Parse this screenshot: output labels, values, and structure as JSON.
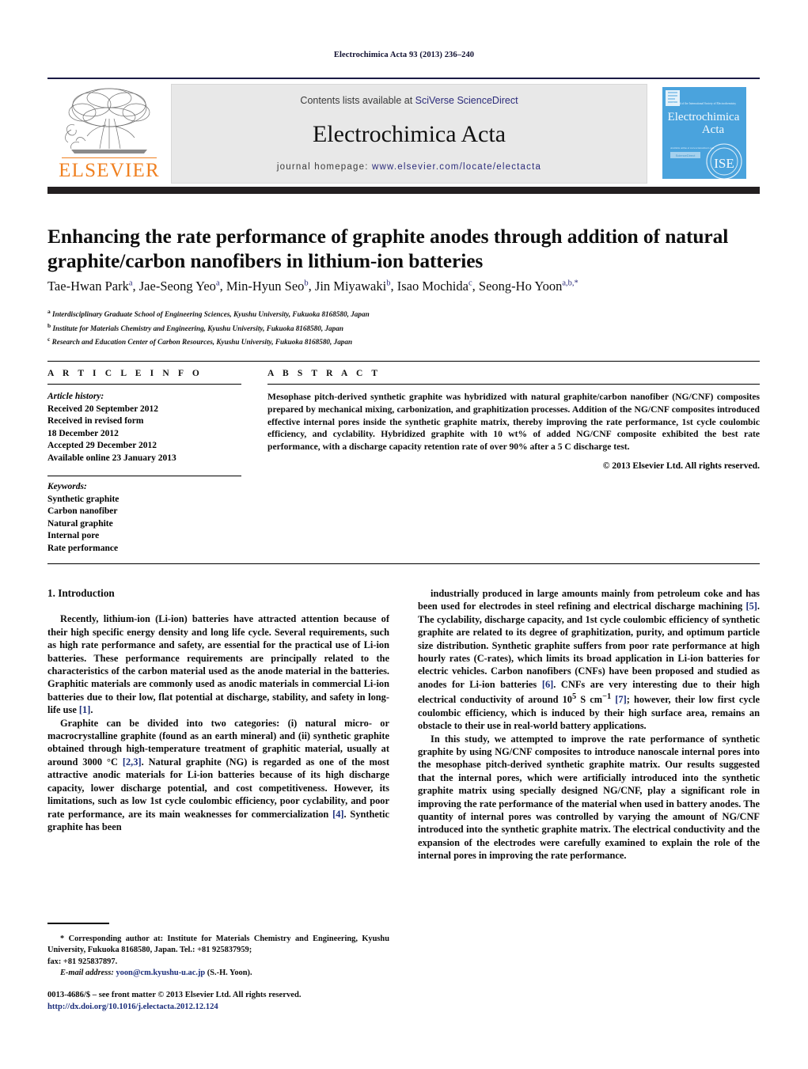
{
  "running_head": "Electrochimica Acta 93 (2013) 236–240",
  "masthead": {
    "contents_prefix": "Contents lists available at ",
    "contents_link": "SciVerse ScienceDirect",
    "journal_title": "Electrochimica Acta",
    "homepage_prefix": "journal homepage: ",
    "homepage_link": "www.elsevier.com/locate/electacta",
    "publisher_name": "ELSEVIER",
    "cover_title_line1": "Electrochimica",
    "cover_title_line2": "Acta",
    "cover_society_mark": "ISE",
    "cover_top_caption": "Journal of the International Society of Electrochemistry",
    "colors": {
      "link": "#2b2b7a",
      "publisher_orange": "#f08020",
      "cover_blue": "#4aa3dd",
      "dark_bar": "#231f20"
    }
  },
  "article": {
    "title": "Enhancing the rate performance of graphite anodes through addition of natural graphite/carbon nanofibers in lithium-ion batteries",
    "authors_html": "Tae-Hwan Park<sup>a</sup>, Jae-Seong Yeo<sup>a</sup>, Min-Hyun Seo<sup>b</sup>, Jin Miyawaki<sup>b</sup>, Isao Mochida<sup>c</sup>, Seong-Ho Yoon<sup>a,b,*</sup>",
    "affiliations": [
      "Interdisciplinary Graduate School of Engineering Sciences, Kyushu University, Fukuoka 8168580, Japan",
      "Institute for Materials Chemistry and Engineering, Kyushu University, Fukuoka 8168580, Japan",
      "Research and Education Center of Carbon Resources, Kyushu University, Fukuoka 8168580, Japan"
    ],
    "affiliation_markers": [
      "a",
      "b",
      "c"
    ]
  },
  "info": {
    "heading": "A R T I C L E   I N F O",
    "history_label": "Article history:",
    "history": [
      "Received 20 September 2012",
      "Received in revised form",
      "18 December 2012",
      "Accepted 29 December 2012",
      "Available online 23 January 2013"
    ],
    "keywords_label": "Keywords:",
    "keywords": [
      "Synthetic graphite",
      "Carbon nanofiber",
      "Natural graphite",
      "Internal pore",
      "Rate performance"
    ]
  },
  "abstract": {
    "heading": "A B S T R A C T",
    "text": "Mesophase pitch-derived synthetic graphite was hybridized with natural graphite/carbon nanofiber (NG/CNF) composites prepared by mechanical mixing, carbonization, and graphitization processes. Addition of the NG/CNF composites introduced effective internal pores inside the synthetic graphite matrix, thereby improving the rate performance, 1st cycle coulombic efficiency, and cyclability. Hybridized graphite with 10 wt% of added NG/CNF composite exhibited the best rate performance, with a discharge capacity retention rate of over 90% after a 5 C discharge test.",
    "copyright": "© 2013 Elsevier Ltd. All rights reserved."
  },
  "body": {
    "section_heading": "1.  Introduction",
    "left_paragraph_1_html": "Recently, lithium-ion (Li-ion) batteries have attracted attention because of their high specific energy density and long life cycle. Several requirements, such as high rate performance and safety, are essential for the practical use of Li-ion batteries. These performance requirements are principally related to the characteristics of the carbon material used as the anode material in the batteries. Graphitic materials are commonly used as anodic materials in commercial Li-ion batteries due to their low, flat potential at discharge, stability, and safety in long-life use <span class=\"ref\">[1]</span>.",
    "left_paragraph_2_html": "Graphite can be divided into two categories: (i) natural micro- or macrocrystalline graphite (found as an earth mineral) and (ii) synthetic graphite obtained through high-temperature treatment of graphitic material, usually at around 3000 °C <span class=\"ref\">[2,3]</span>. Natural graphite (NG) is regarded as one of the most attractive anodic materials for Li-ion batteries because of its high discharge capacity, lower discharge potential, and cost competitiveness. However, its limitations, such as low 1st cycle coulombic efficiency, poor cyclability, and poor rate performance, are its main weaknesses for commercialization <span class=\"ref\">[4]</span>. Synthetic graphite has been",
    "right_paragraph_1_html": "industrially produced in large amounts mainly from petroleum coke and has been used for electrodes in steel refining and electrical discharge machining <span class=\"ref\">[5]</span>. The cyclability, discharge capacity, and 1st cycle coulombic efficiency of synthetic graphite are related to its degree of graphitization, purity, and optimum particle size distribution. Synthetic graphite suffers from poor rate performance at high hourly rates (C-rates), which limits its broad application in Li-ion batteries for electric vehicles. Carbon nanofibers (CNFs) have been proposed and studied as anodes for Li-ion batteries <span class=\"ref\">[6]</span>. CNFs are very interesting due to their high electrical conductivity of around 10<sup>5</sup> S cm<sup>−1</sup> <span class=\"ref\">[7]</span>; however, their low first cycle coulombic efficiency, which is induced by their high surface area, remains an obstacle to their use in real-world battery applications.",
    "right_paragraph_2_html": "In this study, we attempted to improve the rate performance of synthetic graphite by using NG/CNF composites to introduce nanoscale internal pores into the mesophase pitch-derived synthetic graphite matrix. Our results suggested that the internal pores, which were artificially introduced into the synthetic graphite matrix using specially designed NG/CNF, play a significant role in improving the rate performance of the material when used in battery anodes. The quantity of internal pores was controlled by varying the amount of NG/CNF introduced into the synthetic graphite matrix. The electrical conductivity and the expansion of the electrodes were carefully examined to explain the role of the internal pores in improving the rate performance."
  },
  "footnote": {
    "corresponding_html": "<span class=\"indent\">* Corresponding author at: Institute for Materials Chemistry and Engineering, Kyushu University, Fukuoka 8168580, Japan. Tel.: +81 925837959;</span>fax: +81 925837897.",
    "email_label": "E-mail address:",
    "email": "yoon@cm.kyushu-u.ac.jp",
    "email_suffix": " (S.-H. Yoon)."
  },
  "frontmatter": {
    "issn_line": "0013-4686/$ – see front matter © 2013 Elsevier Ltd. All rights reserved.",
    "doi": "http://dx.doi.org/10.1016/j.electacta.2012.12.124"
  }
}
